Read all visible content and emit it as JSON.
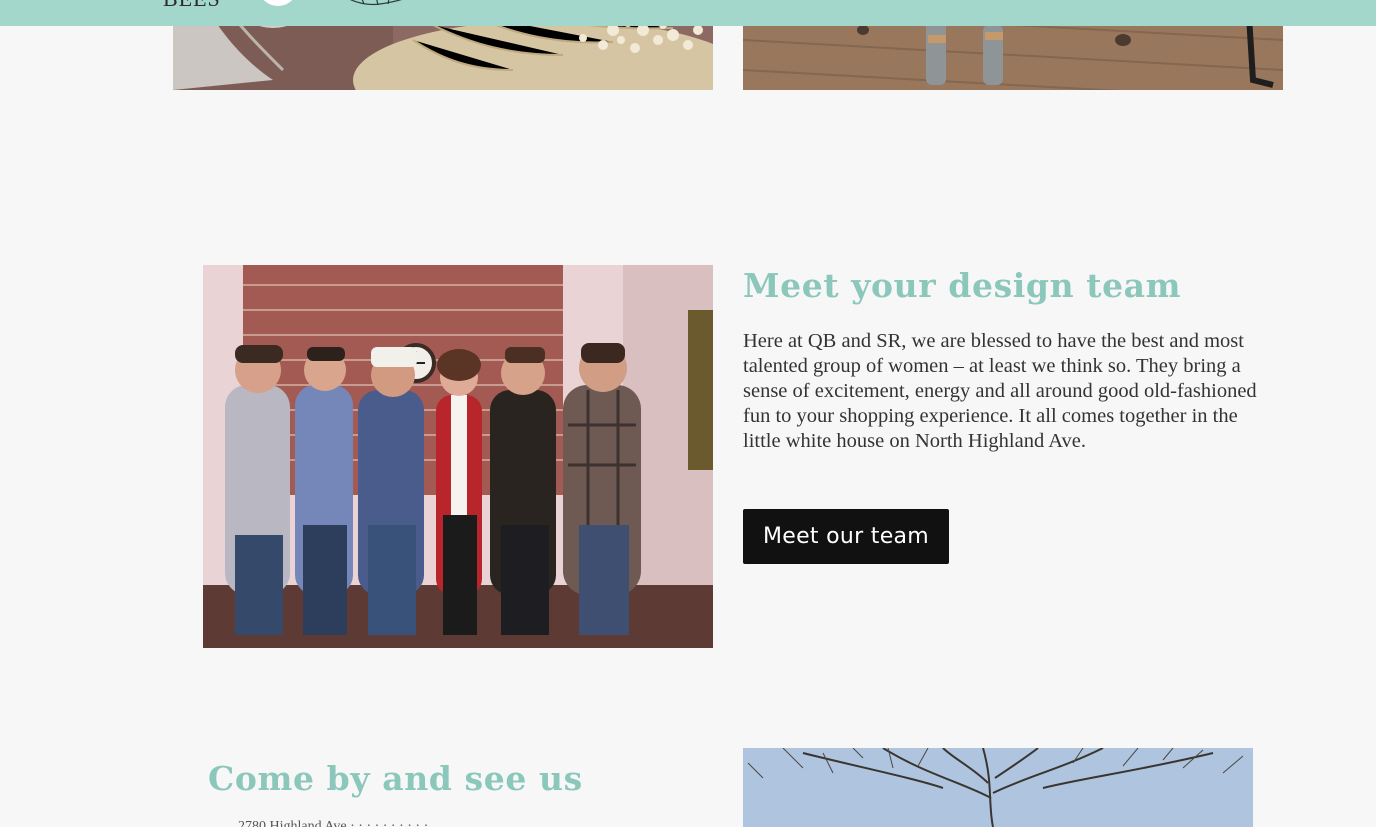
{
  "header": {
    "logo_text": "BEES",
    "logo_circle_icon": "logo-circle-icon",
    "logo_tree_icon": "tree-illustration-icon",
    "background_color": "#a3d7cc"
  },
  "gallery": {
    "top_left_photo_alt": "Knitted pillows with popcorn",
    "top_right_photo_alt": "Wooden deck with tools"
  },
  "team_section": {
    "heading": "Meet your design team",
    "body": "Here at QB and SR, we are blessed to have the best and most talented group of women – at least we think so. They bring a sense of excitement, energy and all around good old-fashioned fun to your shopping experience. It all comes together in the little white house on North Highland Ave.",
    "button_label": "Meet our team",
    "photo_alt": "Vintage group photo of the design team",
    "heading_color": "#8cc7bb",
    "button_color": "#111111"
  },
  "visit_section": {
    "heading": "Come by and see us",
    "address_partial": "2780 Highland Ave · · · · · · · · · ·",
    "photo_alt": "Bare trees against a blue sky"
  }
}
